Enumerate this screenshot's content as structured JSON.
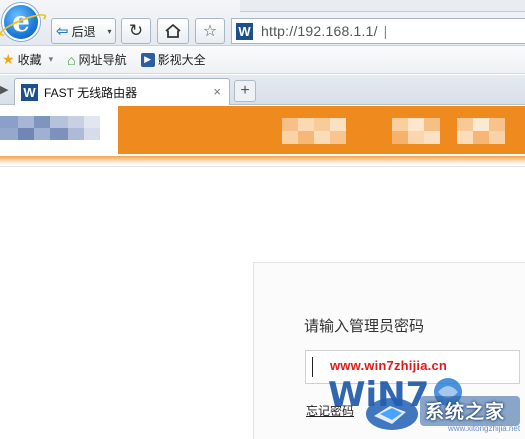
{
  "toolbar": {
    "back_label": "后退",
    "back_dropdown": "▾",
    "refresh_glyph": "↻",
    "favorite_glyph": "☆",
    "site_icon_letter": "W",
    "url": "http://192.168.1.1/",
    "url_separator": "|"
  },
  "favorites_bar": {
    "items": [
      {
        "label": "收藏",
        "icon": "star-icon"
      },
      {
        "label": "网址导航",
        "icon": "navigation-icon"
      },
      {
        "label": "影视大全",
        "icon": "video-icon"
      }
    ],
    "dropdown_glyph": "▾"
  },
  "tabs": {
    "scroll_glyph": "▶",
    "items": [
      {
        "icon_letter": "W",
        "label": "FAST 无线路由器",
        "close_glyph": "×"
      }
    ],
    "new_tab_glyph": "+"
  },
  "login": {
    "prompt": "请输入管理员密码",
    "forgot_link": "忘记密码"
  },
  "watermark": {
    "url": "www.win7zhijia.cn",
    "brand": "系统之家",
    "domain": "www.xitongzhijia.net"
  },
  "colors": {
    "header_orange": "#ef8b1e",
    "watermark_red": "#e61919",
    "ie_blue": "#1a7ad8"
  }
}
